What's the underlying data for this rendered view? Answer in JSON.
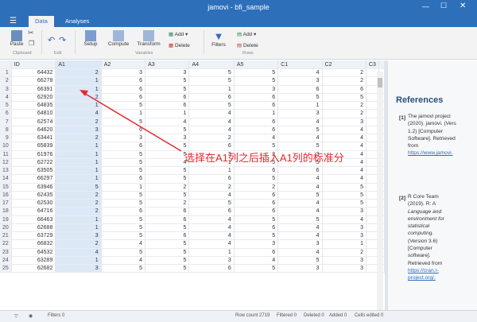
{
  "window": {
    "title": "jamovi - bfi_sample"
  },
  "menu_icon": "hamburger-menu-icon",
  "tabs": [
    {
      "label": "Data"
    },
    {
      "label": "Analyses"
    }
  ],
  "ribbon": {
    "paste": "Paste",
    "clipboard_group": "Clipboard",
    "edit_group": "Edit",
    "setup": "Setup",
    "compute": "Compute",
    "transform": "Transform",
    "add": "Add",
    "delete": "Delete",
    "variables_group": "Variables",
    "filters": "Filters",
    "add2": "Add",
    "delete2": "Delete",
    "rows_group": "Rows"
  },
  "grid": {
    "columns": [
      "ID",
      "A1",
      "A2",
      "A3",
      "A4",
      "A5",
      "C1",
      "C2",
      "C3"
    ],
    "rows": [
      {
        "n": "1",
        "v": [
          "64432",
          "2",
          "3",
          "3",
          "5",
          "5",
          "4",
          "2"
        ]
      },
      {
        "n": "2",
        "v": [
          "66278",
          "1",
          "6",
          "5",
          "5",
          "5",
          "3",
          "2"
        ]
      },
      {
        "n": "3",
        "v": [
          "66391",
          "1",
          "6",
          "5",
          "1",
          "3",
          "6",
          "6"
        ]
      },
      {
        "n": "4",
        "v": [
          "62920",
          "2",
          "6",
          "6",
          "6",
          "6",
          "5",
          "5"
        ]
      },
      {
        "n": "5",
        "v": [
          "64835",
          "1",
          "5",
          "6",
          "5",
          "6",
          "1",
          "2"
        ]
      },
      {
        "n": "6",
        "v": [
          "64810",
          "4",
          "1",
          "1",
          "4",
          "1",
          "3",
          "2"
        ]
      },
      {
        "n": "7",
        "v": [
          "62574",
          "2",
          "5",
          "4",
          "4",
          "6",
          "4",
          "3"
        ]
      },
      {
        "n": "8",
        "v": [
          "64620",
          "3",
          "6",
          "5",
          "4",
          "6",
          "5",
          "4"
        ]
      },
      {
        "n": "9",
        "v": [
          "63441",
          "2",
          "3",
          "3",
          "2",
          "4",
          "4",
          "4"
        ]
      },
      {
        "n": "10",
        "v": [
          "65839",
          "1",
          "6",
          "5",
          "6",
          "5",
          "5",
          "4"
        ]
      },
      {
        "n": "11",
        "v": [
          "61976",
          "1",
          "5",
          "5",
          "3",
          "2",
          "3",
          "4"
        ]
      },
      {
        "n": "12",
        "v": [
          "62722",
          "1",
          "5",
          "4",
          "1",
          "5",
          "5",
          "4"
        ]
      },
      {
        "n": "13",
        "v": [
          "63505",
          "1",
          "5",
          "5",
          "1",
          "6",
          "6",
          "4"
        ]
      },
      {
        "n": "14",
        "v": [
          "66297",
          "1",
          "6",
          "5",
          "6",
          "5",
          "4",
          "4"
        ]
      },
      {
        "n": "15",
        "v": [
          "63946",
          "5",
          "1",
          "2",
          "2",
          "2",
          "4",
          "5"
        ]
      },
      {
        "n": "16",
        "v": [
          "62435",
          "2",
          "5",
          "5",
          "4",
          "6",
          "5",
          "5"
        ]
      },
      {
        "n": "17",
        "v": [
          "62530",
          "2",
          "5",
          "2",
          "5",
          "6",
          "4",
          "5"
        ]
      },
      {
        "n": "18",
        "v": [
          "64716",
          "2",
          "6",
          "6",
          "6",
          "6",
          "4",
          "3"
        ]
      },
      {
        "n": "19",
        "v": [
          "66463",
          "1",
          "5",
          "6",
          "4",
          "5",
          "5",
          "4"
        ]
      },
      {
        "n": "20",
        "v": [
          "62688",
          "1",
          "5",
          "5",
          "4",
          "6",
          "4",
          "3"
        ]
      },
      {
        "n": "21",
        "v": [
          "63729",
          "3",
          "5",
          "6",
          "4",
          "5",
          "4",
          "3"
        ]
      },
      {
        "n": "22",
        "v": [
          "66832",
          "2",
          "4",
          "5",
          "4",
          "3",
          "3",
          "1"
        ]
      },
      {
        "n": "23",
        "v": [
          "64532",
          "4",
          "5",
          "5",
          "1",
          "6",
          "4",
          "2"
        ]
      },
      {
        "n": "24",
        "v": [
          "63289",
          "1",
          "4",
          "5",
          "3",
          "4",
          "5",
          "3"
        ]
      },
      {
        "n": "25",
        "v": [
          "62682",
          "3",
          "5",
          "5",
          "6",
          "5",
          "3",
          "3"
        ]
      }
    ]
  },
  "annotation": {
    "text": "选择在A1列之后插入A1列的标准分",
    "color": "#e4292f"
  },
  "references": {
    "heading": "References",
    "items": [
      {
        "num": "[1]",
        "lines": [
          "The jamovi project",
          "(2020). jamovi. (Vers",
          "1.2) [Computer",
          "Software]. Retrieved",
          "from",
          "https://www.jamovi."
        ]
      },
      {
        "num": "[2]",
        "lines": [
          "R Core Team",
          "(2019). R: A",
          "Language and",
          "environment for",
          "statistical",
          "computing.",
          "(Version 3.6)",
          "[Computer",
          "software].",
          "Retrieved from",
          "https://cran.r-",
          "project.org/."
        ]
      }
    ]
  },
  "status": {
    "filters": "Filters 0",
    "row_count": "Row count 2719",
    "filtered": "Filtered 0",
    "deleted": "Deleted 0",
    "added": "Added 0",
    "cells_edited": "Cells edited 0"
  }
}
